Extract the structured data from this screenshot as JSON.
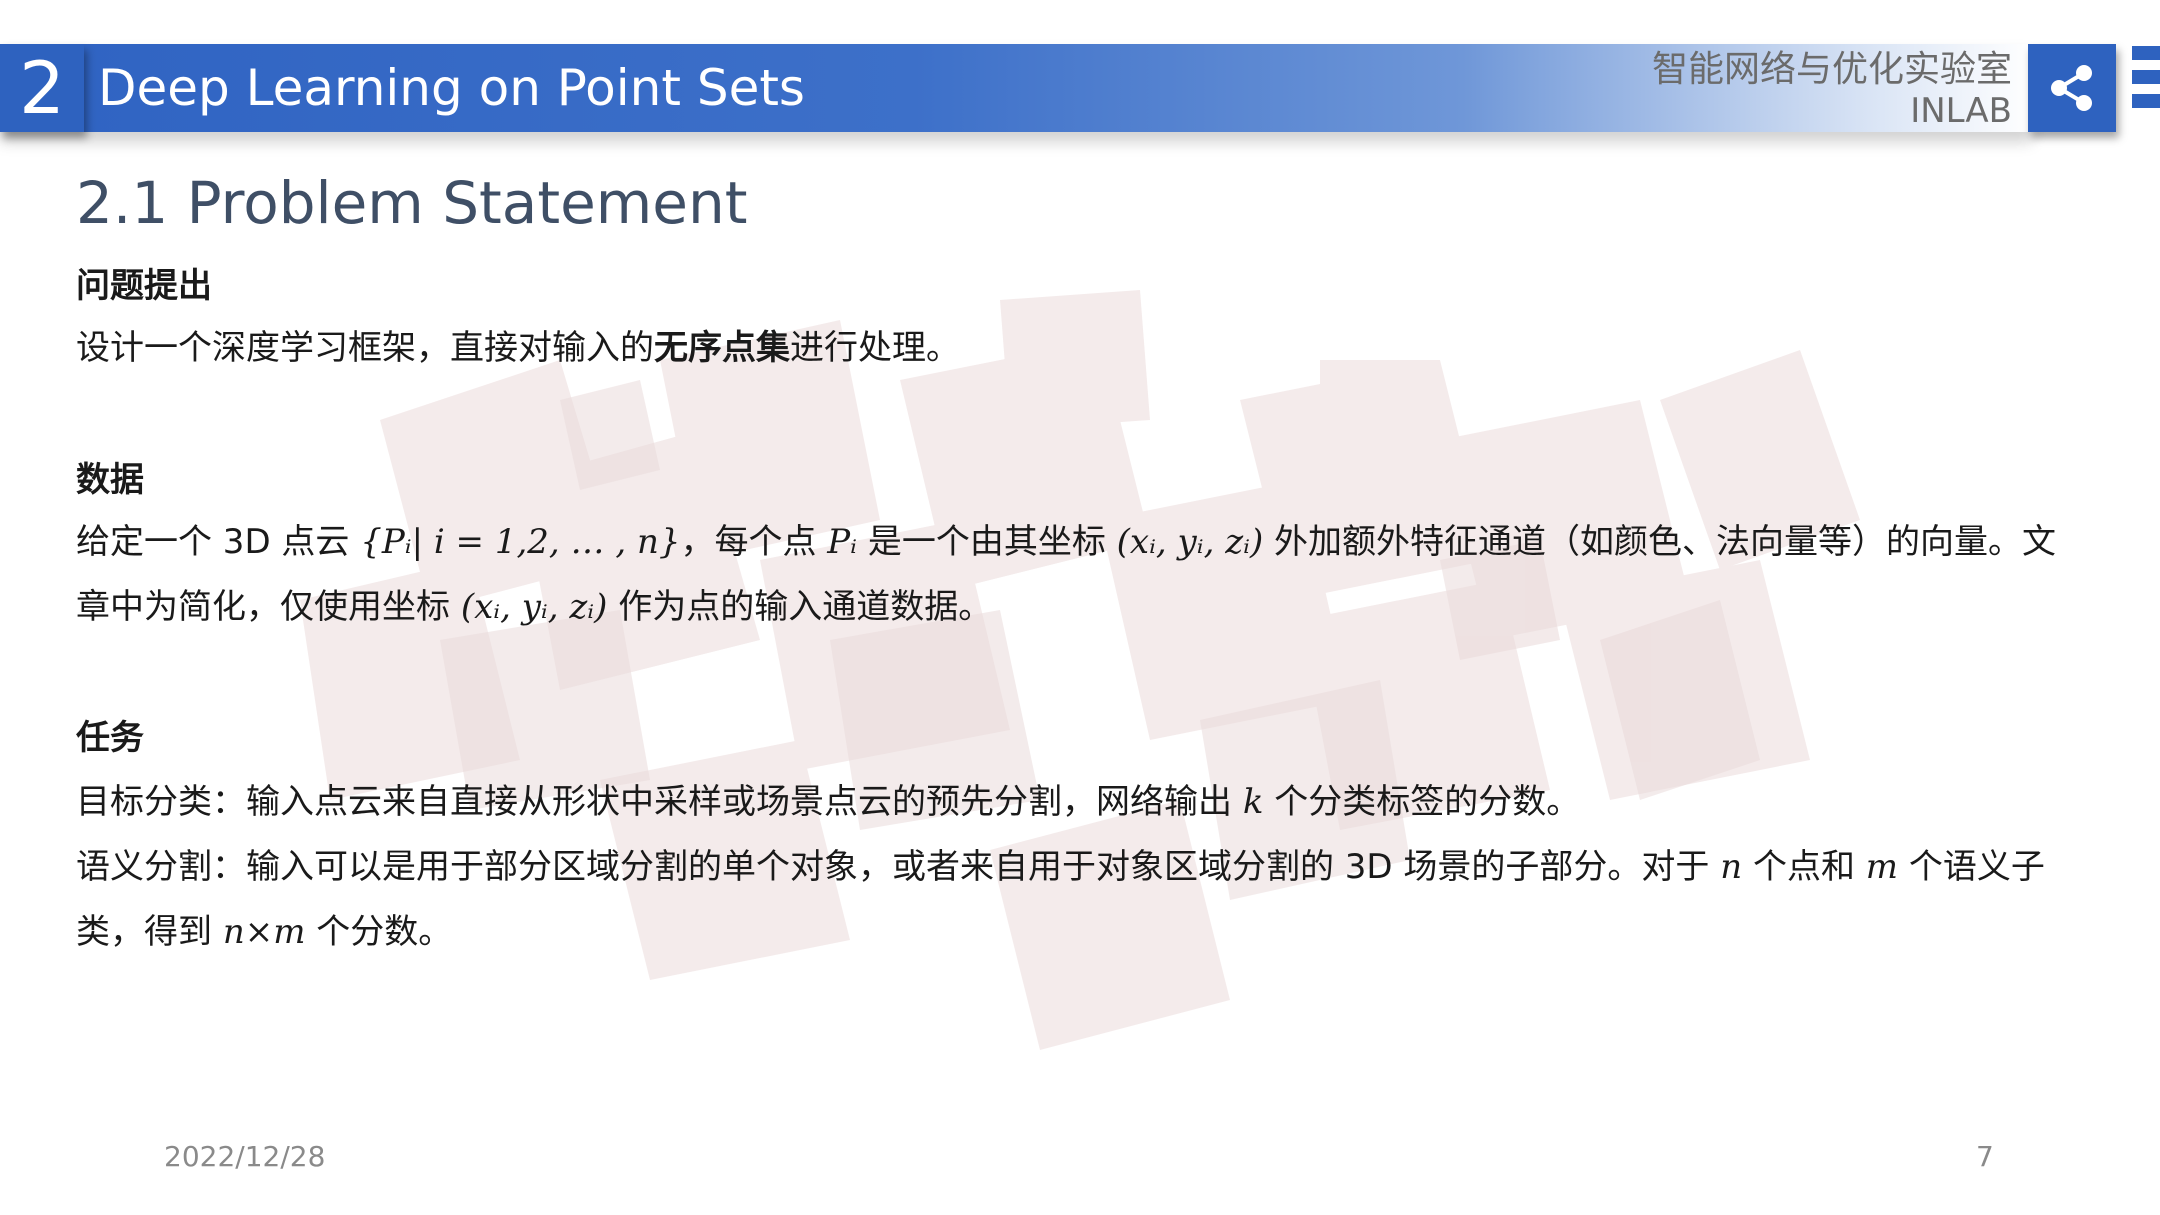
{
  "header": {
    "section_number": "2",
    "title": "Deep Learning on Point Sets",
    "lab_name": "智能网络与优化实验室",
    "lab_abbr": "INLAB",
    "share_icon": "share-icon",
    "menu_icon": "menu-icon"
  },
  "section": {
    "heading": "2.1  Problem Statement"
  },
  "problem": {
    "title": "问题提出",
    "text_before": "设计一个深度学习框架，直接对输入的",
    "text_bold": "无序点集",
    "text_after": "进行处理。"
  },
  "data_block": {
    "title": "数据",
    "line1_a": "给定一个 3D 点云 ",
    "set_expr": "{Pᵢ| i = 1,2, … , n}",
    "line1_b": "，每个点 ",
    "point_expr": "Pᵢ",
    "line1_c": " 是一个由其坐标 ",
    "coord_expr_1": "(xᵢ, yᵢ, zᵢ)",
    "line1_d": " 外加额外特征通道（如颜色、法向量等）的向量。文章中为简化，仅使用坐标 ",
    "coord_expr_2": "(xᵢ, yᵢ, zᵢ)",
    "line1_e": " 作为点的输入通道数据。"
  },
  "task_block": {
    "title": "任务",
    "classification_a": "目标分类：输入点云来自直接从形状中采样或场景点云的预先分割，网络输出 ",
    "classification_k": "k",
    "classification_b": " 个分类标签的分数。",
    "segmentation_a": "语义分割：输入可以是用于部分区域分割的单个对象，或者来自用于对象区域分割的 3D 场景的子部分。对于 ",
    "segmentation_n": "n",
    "segmentation_b": " 个点和 ",
    "segmentation_m": "m",
    "segmentation_c": " 个语义子类，得到 ",
    "segmentation_nm": "n×m",
    "segmentation_d": " 个分数。"
  },
  "footer": {
    "date": "2022/12/28",
    "page": "7"
  },
  "colors": {
    "header_blue": "#2e62bf",
    "heading_text": "#3f4f66",
    "watermark": "#ecdcdc"
  }
}
